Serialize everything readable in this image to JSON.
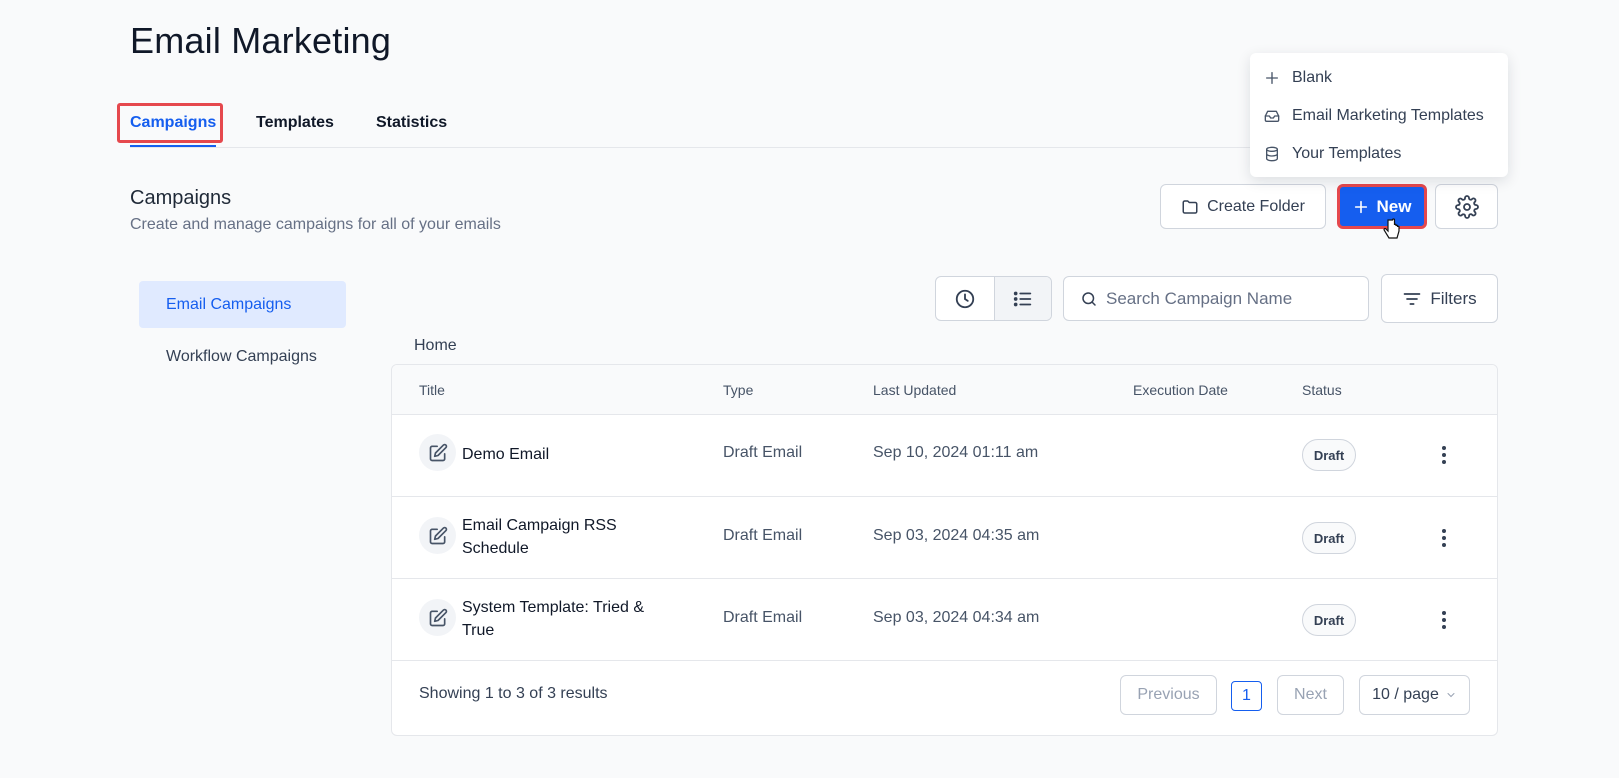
{
  "page": {
    "title": "Email Marketing"
  },
  "tabs": [
    {
      "label": "Campaigns",
      "active": true
    },
    {
      "label": "Templates",
      "active": false
    },
    {
      "label": "Statistics",
      "active": false
    }
  ],
  "section": {
    "title": "Campaigns",
    "subtitle": "Create and manage campaigns for all of your emails"
  },
  "actions": {
    "create_folder": "Create Folder",
    "new": "New",
    "settings_icon": "gear-icon"
  },
  "dropdown": {
    "items": [
      {
        "label": "Blank",
        "icon": "plus-icon"
      },
      {
        "label": "Email Marketing Templates",
        "icon": "inbox-icon"
      },
      {
        "label": "Your Templates",
        "icon": "database-icon"
      }
    ]
  },
  "sidebar": {
    "items": [
      {
        "label": "Email Campaigns",
        "active": true
      },
      {
        "label": "Workflow Campaigns",
        "active": false
      }
    ]
  },
  "toolbar": {
    "search_placeholder": "Search Campaign Name",
    "filters": "Filters"
  },
  "breadcrumb": "Home",
  "table": {
    "columns": [
      "Title",
      "Type",
      "Last Updated",
      "Execution Date",
      "Status"
    ],
    "rows": [
      {
        "title": "Demo Email",
        "type": "Draft Email",
        "last_updated": "Sep 10, 2024 01:11 am",
        "execution_date": "",
        "status": "Draft"
      },
      {
        "title": "Email Campaign RSS Schedule",
        "type": "Draft Email",
        "last_updated": "Sep 03, 2024 04:35 am",
        "execution_date": "",
        "status": "Draft"
      },
      {
        "title": "System Template: Tried & True",
        "type": "Draft Email",
        "last_updated": "Sep 03, 2024 04:34 am",
        "execution_date": "",
        "status": "Draft"
      }
    ]
  },
  "pagination": {
    "summary": "Showing 1 to 3 of 3 results",
    "previous": "Previous",
    "current_page": "1",
    "next": "Next",
    "page_size": "10 / page"
  },
  "colors": {
    "accent": "#155eef",
    "highlight": "#e5484d"
  }
}
